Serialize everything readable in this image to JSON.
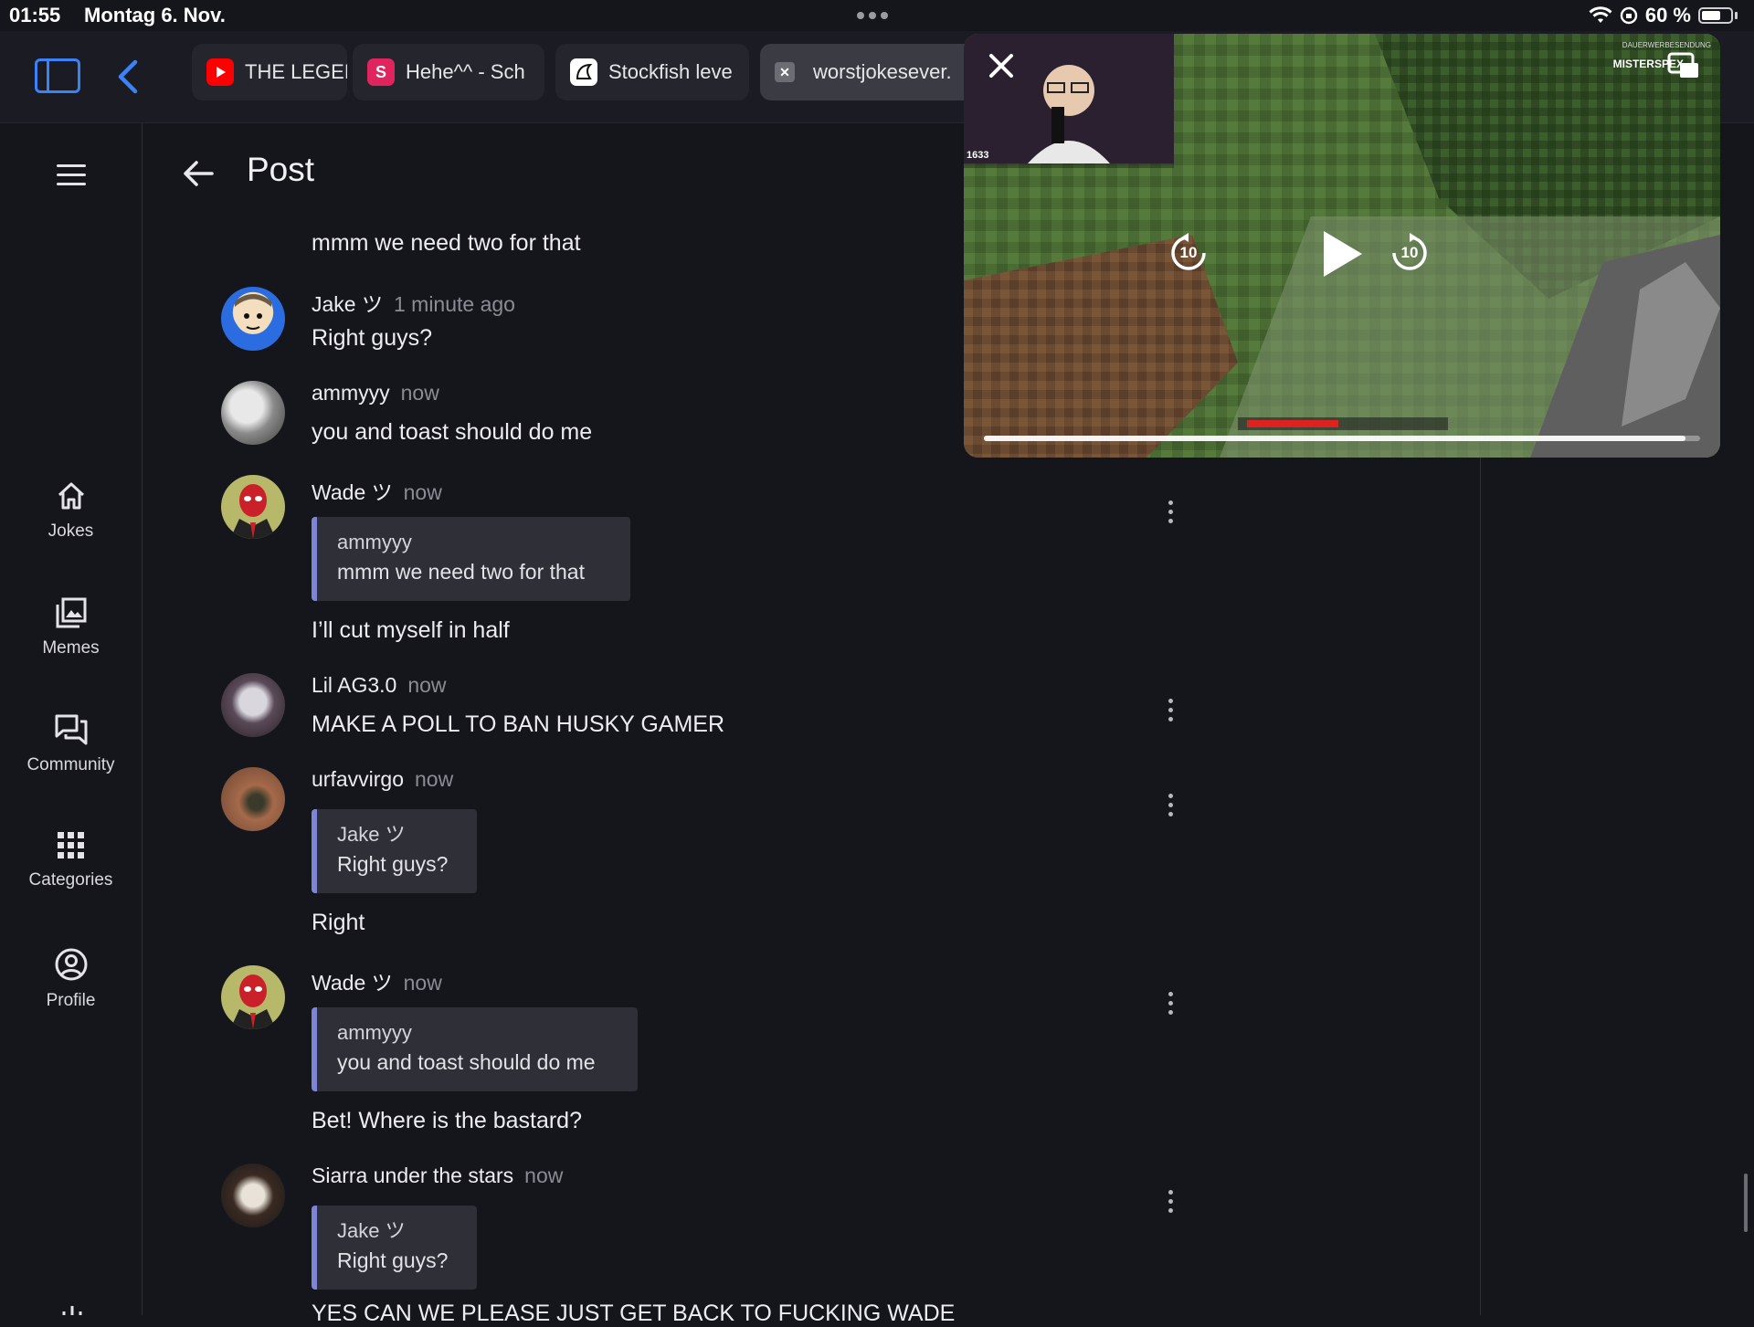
{
  "status_bar": {
    "time": "01:55",
    "date": "Montag 6. Nov.",
    "battery": "60 %"
  },
  "browser": {
    "tabs": [
      {
        "label": "THE LEGEI",
        "icon": "youtube-icon",
        "color": "#ff0000",
        "glyph": ""
      },
      {
        "label": "Hehe^^ - Sch",
        "icon": "s-app-icon",
        "color": "#e0245e",
        "glyph": "S"
      },
      {
        "label": "Stockfish leve",
        "icon": "stockfish-icon",
        "color": "#ffffff",
        "glyph": ""
      },
      {
        "label": "worstjokesever.",
        "icon": "close-tab-icon",
        "color": "#6b6c74",
        "glyph": "✕"
      }
    ]
  },
  "nav": {
    "items": [
      {
        "label": "Jokes",
        "icon": "home-icon"
      },
      {
        "label": "Memes",
        "icon": "image-icon"
      },
      {
        "label": "Community",
        "icon": "forum-icon"
      },
      {
        "label": "Categories",
        "icon": "grid-icon"
      },
      {
        "label": "Profile",
        "icon": "account-icon"
      }
    ]
  },
  "page": {
    "title": "Post"
  },
  "top_text": "mmm we need two for that",
  "comments": [
    {
      "author": "Jake ツ",
      "time": "1 minute ago",
      "quote": null,
      "text": "Right guys?"
    },
    {
      "author": "ammyyy",
      "time": "now",
      "quote": null,
      "text": "you and toast should do me"
    },
    {
      "author": "Wade ツ",
      "time": "now",
      "quote": {
        "author": "ammyyy",
        "text": "mmm we need two for that"
      },
      "text": "I’ll cut myself in half"
    },
    {
      "author": "Lil AG3.0",
      "time": "now",
      "quote": null,
      "text": "MAKE A POLL TO BAN HUSKY GAMER"
    },
    {
      "author": "urfavvirgo",
      "time": "now",
      "quote": {
        "author": "Jake ツ",
        "text": "Right guys?"
      },
      "text": "Right"
    },
    {
      "author": "Wade ツ",
      "time": "now",
      "quote": {
        "author": "ammyyy",
        "text": "you and toast should do me"
      },
      "text": "Bet! Where is the bastard?"
    },
    {
      "author": "Siarra under the stars",
      "time": "now",
      "quote": {
        "author": "Jake ツ",
        "text": "Right guys?"
      },
      "text": "YES CAN WE PLEASE JUST GET BACK TO FUCKING WADE"
    }
  ],
  "video": {
    "channel": "MISTERSPEX",
    "brand": "DAUERWERBESENDUNG",
    "viewer_count": "1633",
    "rewind_seconds": "10",
    "forward_seconds": "10",
    "progress": 0.98
  }
}
